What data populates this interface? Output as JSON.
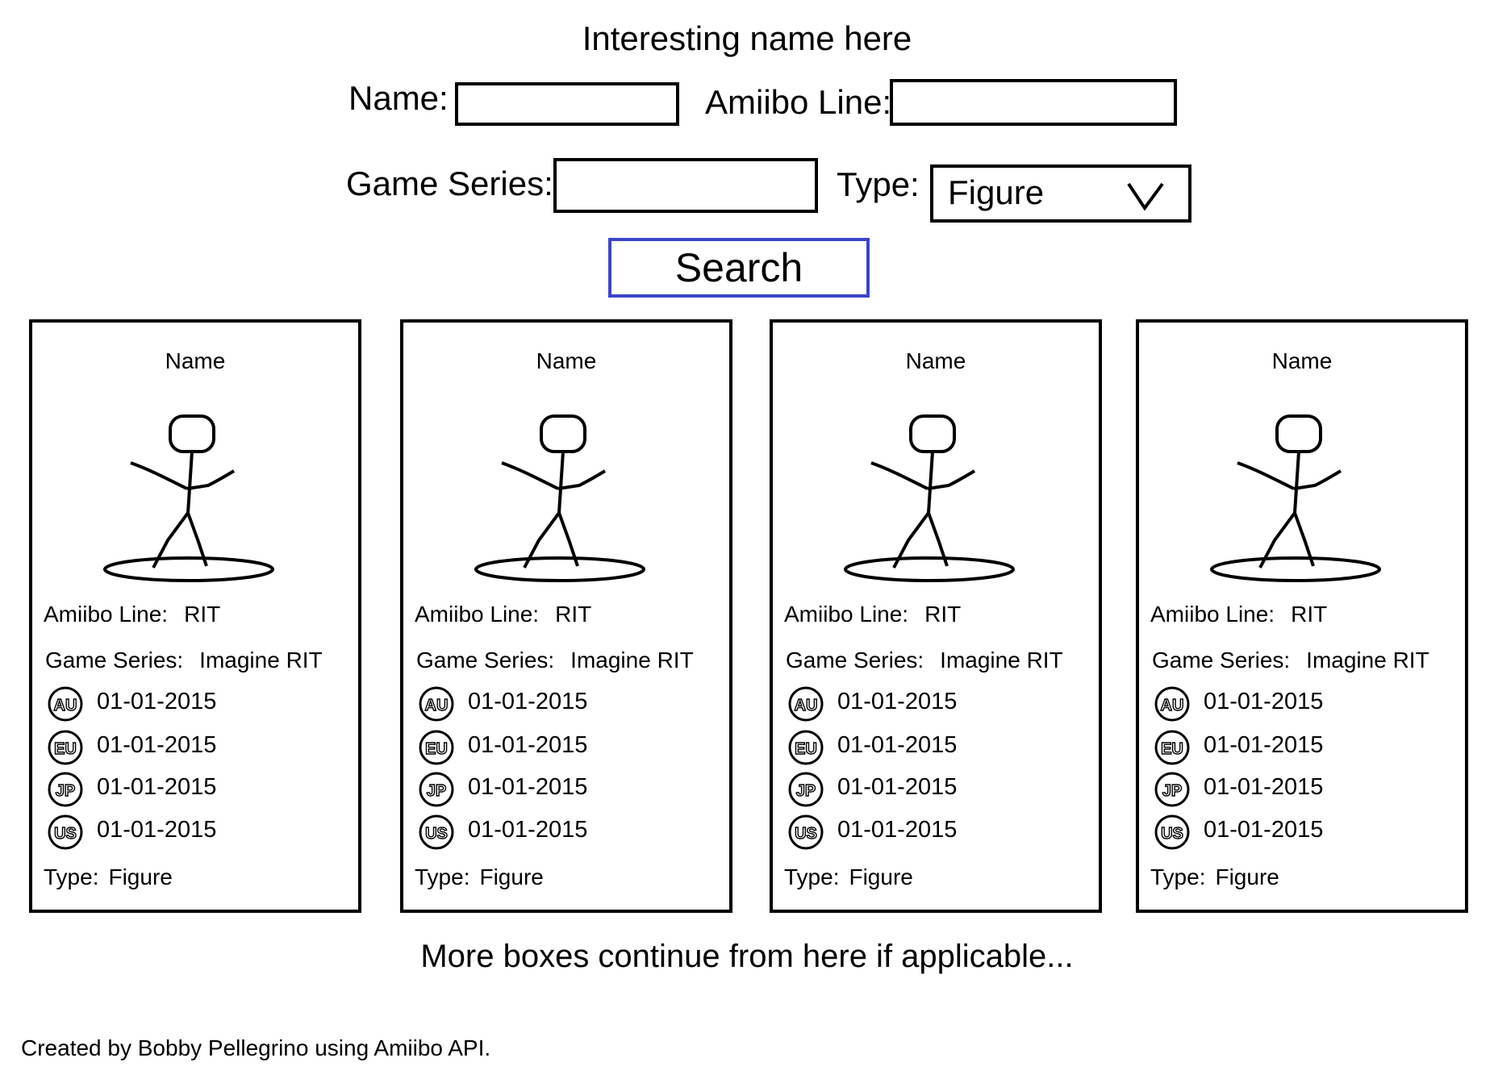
{
  "header": {
    "title": "Interesting name here"
  },
  "search_form": {
    "name_label": "Name:",
    "name_value": "",
    "line_label": "Amiibo Line:",
    "line_value": "",
    "series_label": "Game Series:",
    "series_value": "",
    "type_label": "Type:",
    "type_selected": "Figure",
    "search_button": "Search"
  },
  "cards": [
    {
      "name": "Name",
      "amiibo_line_label": "Amiibo Line:",
      "amiibo_line": "RIT",
      "game_series_label": "Game Series:",
      "game_series": "Imagine RIT",
      "releases": [
        {
          "region": "AU",
          "date": "01-01-2015"
        },
        {
          "region": "EU",
          "date": "01-01-2015"
        },
        {
          "region": "JP",
          "date": "01-01-2015"
        },
        {
          "region": "US",
          "date": "01-01-2015"
        }
      ],
      "type_label": "Type:",
      "type": "Figure"
    },
    {
      "name": "Name",
      "amiibo_line_label": "Amiibo Line:",
      "amiibo_line": "RIT",
      "game_series_label": "Game Series:",
      "game_series": "Imagine RIT",
      "releases": [
        {
          "region": "AU",
          "date": "01-01-2015"
        },
        {
          "region": "EU",
          "date": "01-01-2015"
        },
        {
          "region": "JP",
          "date": "01-01-2015"
        },
        {
          "region": "US",
          "date": "01-01-2015"
        }
      ],
      "type_label": "Type:",
      "type": "Figure"
    },
    {
      "name": "Name",
      "amiibo_line_label": "Amiibo Line:",
      "amiibo_line": "RIT",
      "game_series_label": "Game Series:",
      "game_series": "Imagine RIT",
      "releases": [
        {
          "region": "AU",
          "date": "01-01-2015"
        },
        {
          "region": "EU",
          "date": "01-01-2015"
        },
        {
          "region": "JP",
          "date": "01-01-2015"
        },
        {
          "region": "US",
          "date": "01-01-2015"
        }
      ],
      "type_label": "Type:",
      "type": "Figure"
    },
    {
      "name": "Name",
      "amiibo_line_label": "Amiibo Line:",
      "amiibo_line": "RIT",
      "game_series_label": "Game Series:",
      "game_series": "Imagine RIT",
      "releases": [
        {
          "region": "AU",
          "date": "01-01-2015"
        },
        {
          "region": "EU",
          "date": "01-01-2015"
        },
        {
          "region": "JP",
          "date": "01-01-2015"
        },
        {
          "region": "US",
          "date": "01-01-2015"
        }
      ],
      "type_label": "Type:",
      "type": "Figure"
    }
  ],
  "more_text": "More boxes continue from here if applicable...",
  "footer": "Created by Bobby Pellegrino using Amiibo API.",
  "colors": {
    "search_border": "#3b45cc",
    "ink": "#000000",
    "background": "#ffffff"
  },
  "icons": {
    "type_dropdown": "chevron-down-icon",
    "figure": "stick-figure-icon",
    "region_badges": [
      "au-region-icon",
      "eu-region-icon",
      "jp-region-icon",
      "us-region-icon"
    ]
  }
}
